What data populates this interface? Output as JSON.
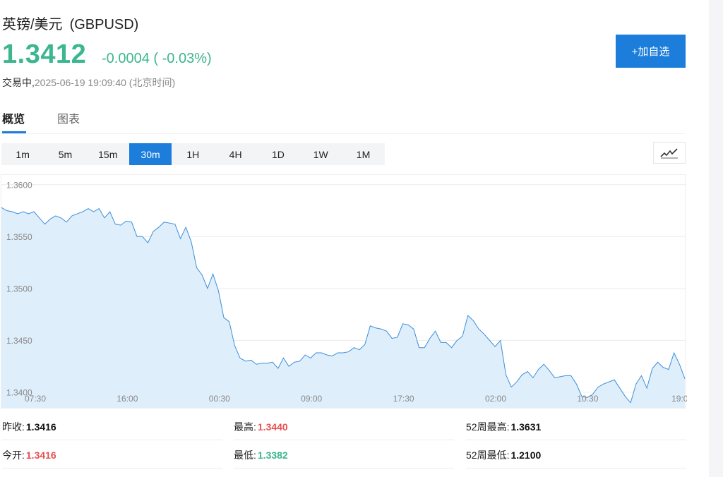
{
  "header": {
    "name": "英镑/美元",
    "symbol": "(GBPUSD)",
    "price": "1.3412",
    "change": "-0.0004 ( -0.03%)",
    "status": "交易中,",
    "timestamp": "2025-06-19 19:09:40 (北京时间)",
    "add_button": "+加自选"
  },
  "tabs": [
    {
      "label": "概览",
      "active": true
    },
    {
      "label": "图表",
      "active": false
    }
  ],
  "intervals": [
    "1m",
    "5m",
    "15m",
    "30m",
    "1H",
    "4H",
    "1D",
    "1W",
    "1M"
  ],
  "selected_interval": "30m",
  "chart_type_icon": "line-chart-icon",
  "colors": {
    "up": "#e8504f",
    "down": "#3cb68f",
    "accent": "#1c7ddb",
    "line": "#3d8fd9",
    "fill": "#dfeefb"
  },
  "chart_data": {
    "type": "area",
    "title": "",
    "xlabel": "",
    "ylabel": "",
    "x_tick_labels": [
      "07:30",
      "16:00",
      "00:30",
      "09:00",
      "17:30",
      "02:00",
      "10:30",
      "19:0"
    ],
    "y_tick_labels": [
      "1.3600",
      "1.3550",
      "1.3500",
      "1.3450",
      "1.3400"
    ],
    "y_ticks": [
      1.36,
      1.355,
      1.35,
      1.345,
      1.34
    ],
    "ylim": [
      1.3385,
      1.3608
    ],
    "grid": "horizontal",
    "values": [
      1.3578,
      1.3575,
      1.3574,
      1.3572,
      1.3574,
      1.3572,
      1.3574,
      1.3568,
      1.3562,
      1.3567,
      1.357,
      1.3568,
      1.3564,
      1.357,
      1.3572,
      1.3574,
      1.3577,
      1.3574,
      1.3577,
      1.3568,
      1.3574,
      1.3562,
      1.3561,
      1.3565,
      1.3564,
      1.355,
      1.355,
      1.3544,
      1.3555,
      1.3559,
      1.3564,
      1.3563,
      1.3562,
      1.3548,
      1.3559,
      1.3545,
      1.352,
      1.3513,
      1.35,
      1.3514,
      1.3498,
      1.3472,
      1.3468,
      1.3445,
      1.3433,
      1.343,
      1.3431,
      1.3427,
      1.3428,
      1.3428,
      1.3429,
      1.3423,
      1.3433,
      1.3425,
      1.3429,
      1.343,
      1.3436,
      1.3433,
      1.3438,
      1.3438,
      1.3436,
      1.3435,
      1.3438,
      1.3438,
      1.3439,
      1.3443,
      1.3441,
      1.3446,
      1.3464,
      1.3462,
      1.3461,
      1.3459,
      1.3452,
      1.3453,
      1.3466,
      1.3465,
      1.3461,
      1.3443,
      1.3443,
      1.3452,
      1.3459,
      1.3448,
      1.3448,
      1.3443,
      1.345,
      1.3454,
      1.3474,
      1.3469,
      1.3461,
      1.3456,
      1.345,
      1.3444,
      1.345,
      1.3417,
      1.3405,
      1.341,
      1.3417,
      1.342,
      1.3414,
      1.3422,
      1.3427,
      1.3421,
      1.3414,
      1.3415,
      1.3416,
      1.3416,
      1.3408,
      1.3396,
      1.3395,
      1.3398,
      1.3405,
      1.3408,
      1.341,
      1.3412,
      1.3404,
      1.3396,
      1.339,
      1.3408,
      1.3416,
      1.3404,
      1.3423,
      1.3429,
      1.3424,
      1.3422,
      1.3438,
      1.3427,
      1.3413
    ]
  },
  "stats": [
    [
      {
        "label": "昨收:",
        "value": "1.3416",
        "color": "black"
      },
      {
        "label": "最高:",
        "value": "1.3440",
        "color": "red"
      },
      {
        "label": "52周最高:",
        "value": "1.3631",
        "color": "black"
      }
    ],
    [
      {
        "label": "今开:",
        "value": "1.3416",
        "color": "red"
      },
      {
        "label": "最低:",
        "value": "1.3382",
        "color": "green"
      },
      {
        "label": "52周最低:",
        "value": "1.2100",
        "color": "black"
      }
    ]
  ]
}
